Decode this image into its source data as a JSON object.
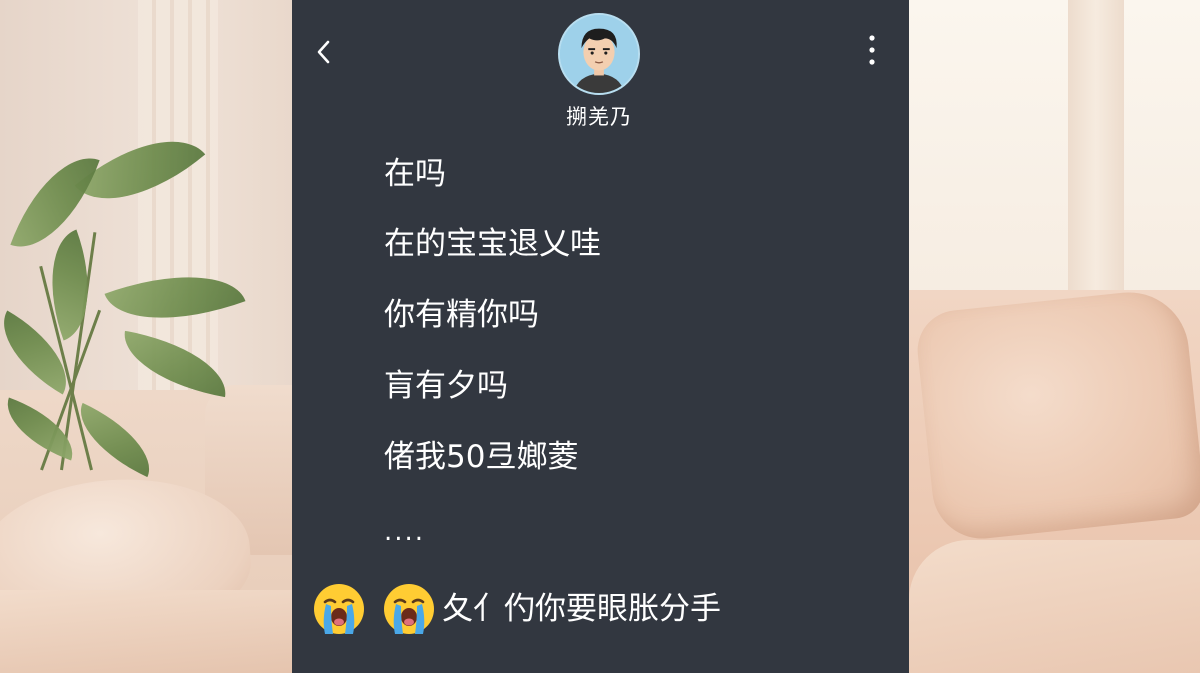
{
  "chat": {
    "contact_name": "搠羌乃",
    "messages": [
      "在吗",
      "在的宝宝退乂哇",
      "你有精你吗",
      "肓有夕吗",
      "偖我50弖嫏菱",
      "....",
      "夂亻仢你要眼胀分手"
    ],
    "last_message_emojis": [
      "loudly-crying-face-icon",
      "loudly-crying-face-icon"
    ]
  },
  "icons": {
    "back": "chevron-left-icon",
    "more": "vertical-ellipsis-icon",
    "avatar": "avatar-boy-icon"
  },
  "colors": {
    "chat_background": "#323740",
    "message_text": "#ffffff",
    "avatar_background": "#9ed1ea"
  }
}
